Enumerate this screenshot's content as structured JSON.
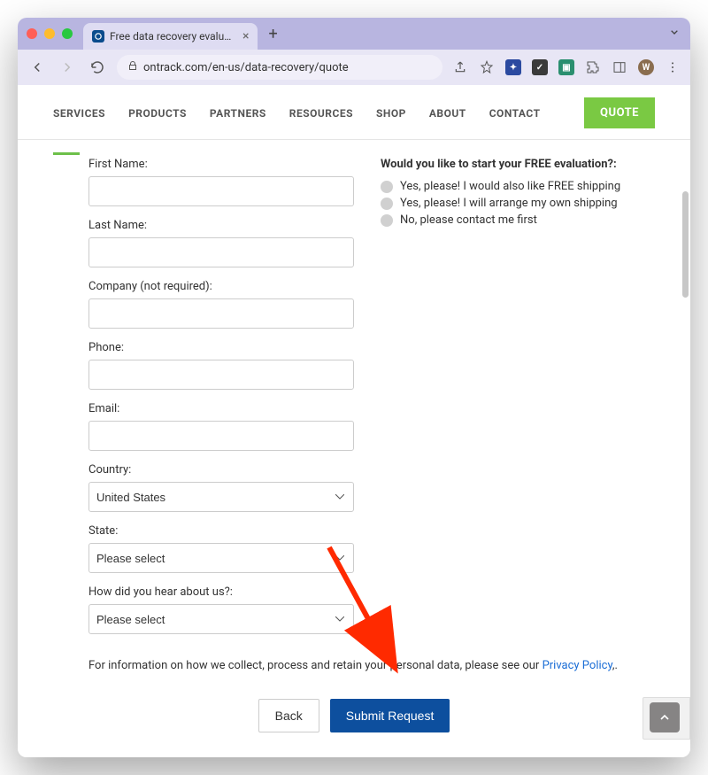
{
  "browser": {
    "tab_title": "Free data recovery evaluation a",
    "url": "ontrack.com/en-us/data-recovery/quote"
  },
  "nav": {
    "items": [
      "SERVICES",
      "PRODUCTS",
      "PARTNERS",
      "RESOURCES",
      "SHOP",
      "ABOUT",
      "CONTACT"
    ],
    "quote_label": "QUOTE"
  },
  "form": {
    "first_name_label": "First Name:",
    "last_name_label": "Last Name:",
    "company_label": "Company (not required):",
    "phone_label": "Phone:",
    "email_label": "Email:",
    "country_label": "Country:",
    "country_value": "United States",
    "state_label": "State:",
    "state_value": "Please select",
    "hear_label": "How did you hear about us?:",
    "hear_value": "Please select"
  },
  "question": {
    "label": "Would you like to start your FREE evaluation?:",
    "options": [
      "Yes, please! I would also like FREE shipping",
      "Yes, please!  I will arrange my own shipping",
      "No, please contact me first"
    ]
  },
  "privacy": {
    "text_before": "For information on how we collect, process and retain your personal data, please see our ",
    "link": "Privacy Policy",
    "text_after": ",."
  },
  "actions": {
    "back": "Back",
    "submit": "Submit Request"
  }
}
